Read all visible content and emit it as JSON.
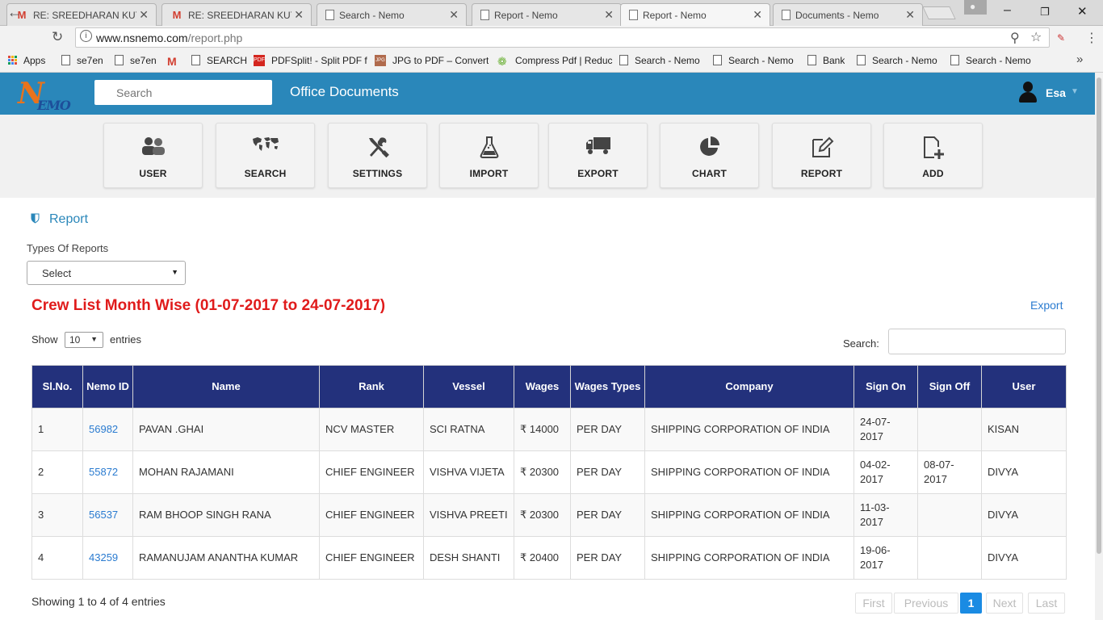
{
  "browser": {
    "tabs": [
      {
        "label": "RE: SREEDHARAN KUTT",
        "icon": "gmail-icon"
      },
      {
        "label": "RE: SREEDHARAN KUTT",
        "icon": "gmail-icon"
      },
      {
        "label": "Search - Nemo",
        "icon": "page-icon"
      },
      {
        "label": "Report - Nemo",
        "icon": "page-icon"
      },
      {
        "label": "Report - Nemo",
        "icon": "page-icon",
        "active": true
      },
      {
        "label": "Documents - Nemo",
        "icon": "page-icon"
      }
    ],
    "url_host": "www.nsnemo.com",
    "url_path": "/report.php",
    "bookmarks": [
      {
        "label": "Apps",
        "icon": "apps-grid-icon"
      },
      {
        "label": "se7en",
        "icon": "page-icon"
      },
      {
        "label": "se7en",
        "icon": "page-icon"
      },
      {
        "label": "",
        "icon": "gmail-icon"
      },
      {
        "label": "SEARCH",
        "icon": "page-icon"
      },
      {
        "label": "PDFSplit! - Split PDF f",
        "icon": "pdf-icon"
      },
      {
        "label": "JPG to PDF – Convert",
        "icon": "jpg-icon"
      },
      {
        "label": "Compress Pdf | Reduc",
        "icon": "compress-icon"
      },
      {
        "label": "Search - Nemo",
        "icon": "page-icon"
      },
      {
        "label": "Search - Nemo",
        "icon": "page-icon"
      },
      {
        "label": "Bank",
        "icon": "page-icon"
      },
      {
        "label": "Search - Nemo",
        "icon": "page-icon"
      },
      {
        "label": "Search - Nemo",
        "icon": "page-icon"
      }
    ]
  },
  "header": {
    "logo_text": "EMO",
    "search_placeholder": "Search",
    "title": "Office Documents",
    "user": "Esa",
    "color": "#2a87ba"
  },
  "modules": [
    {
      "label": "USER",
      "icon": "users-icon"
    },
    {
      "label": "SEARCH",
      "icon": "world-map-icon"
    },
    {
      "label": "SETTINGS",
      "icon": "tools-icon"
    },
    {
      "label": "IMPORT",
      "icon": "flask-icon"
    },
    {
      "label": "EXPORT",
      "icon": "truck-icon"
    },
    {
      "label": "CHART",
      "icon": "pie-chart-icon"
    },
    {
      "label": "REPORT",
      "icon": "edit-icon"
    },
    {
      "label": "ADD",
      "icon": "add-file-icon"
    }
  ],
  "report": {
    "breadcrumb": "Report",
    "types_label": "Types Of Reports",
    "types_selected": "Select",
    "title": "Crew List Month Wise (01-07-2017 to 24-07-2017)",
    "export": "Export",
    "show_label": "Show",
    "show_value": "10",
    "entries_label": "entries",
    "search_label": "Search:",
    "columns": [
      "Sl.No.",
      "Nemo ID",
      "Name",
      "Rank",
      "Vessel",
      "Wages",
      "Wages Types",
      "Company",
      "Sign On",
      "Sign Off",
      "User"
    ],
    "rows": [
      [
        "1",
        "56982",
        "PAVAN .GHAI",
        "NCV MASTER",
        "SCI RATNA",
        "₹ 14000",
        "PER DAY",
        "SHIPPING CORPORATION OF INDIA",
        "24-07-2017",
        "",
        "KISAN"
      ],
      [
        "2",
        "55872",
        "MOHAN RAJAMANI",
        "CHIEF ENGINEER",
        "VISHVA VIJETA",
        "₹ 20300",
        "PER DAY",
        "SHIPPING CORPORATION OF INDIA",
        "04-02-2017",
        "08-07-2017",
        "DIVYA"
      ],
      [
        "3",
        "56537",
        "RAM BHOOP SINGH RANA",
        "CHIEF ENGINEER",
        "VISHVA PREETI",
        "₹ 20300",
        "PER DAY",
        "SHIPPING CORPORATION OF INDIA",
        "11-03-2017",
        "",
        "DIVYA"
      ],
      [
        "4",
        "43259",
        "RAMANUJAM ANANTHA KUMAR",
        "CHIEF ENGINEER",
        "DESH SHANTI",
        "₹ 20400",
        "PER DAY",
        "SHIPPING CORPORATION OF INDIA",
        "19-06-2017",
        "",
        "DIVYA"
      ]
    ],
    "summary": "Showing 1 to 4 of 4 entries",
    "pagination": [
      "First",
      "Previous",
      "1",
      "Next",
      "Last"
    ],
    "current_page": "1",
    "title_color": "#e01b1b",
    "table_header_color": "#23317c"
  }
}
